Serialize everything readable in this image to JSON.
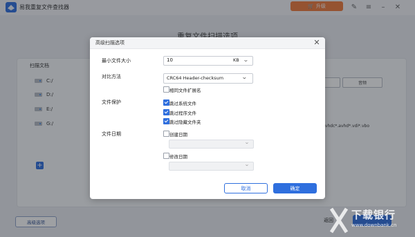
{
  "app": {
    "title": "易我重复文件查找器",
    "upgrade_label": "升级"
  },
  "main": {
    "page_title": "重复文件扫描选项",
    "scan_label": "扫描文档",
    "drives": [
      "C:/",
      "D:/",
      "E:/",
      "G:/"
    ],
    "add_symbol": "+",
    "partial_btn_label": "音频",
    "extensions_text": "*.vhdc*.avhd*.vdi*.vbo",
    "advanced_button": "高级选项",
    "back_button": "返回"
  },
  "dialog": {
    "title": "高级扫描选项",
    "min_size_label": "最小文件大小",
    "min_size_value": "10",
    "min_size_unit": "KB",
    "compare_label": "对比方法",
    "compare_value": "CRC64 Header-checksum",
    "same_ext_label": "相同文件扩展名",
    "same_ext_checked": false,
    "protect_label": "文件保护",
    "protect_options": [
      {
        "label": "跳过系统文件",
        "checked": true
      },
      {
        "label": "跳过程序文件",
        "checked": true
      },
      {
        "label": "跳过隐藏文件夹",
        "checked": true
      }
    ],
    "date_label": "文件日期",
    "created_label": "创建日期",
    "created_checked": false,
    "modified_label": "修改日期",
    "modified_checked": false,
    "cancel_label": "取消",
    "ok_label": "确定"
  },
  "watermark": {
    "main": "下载银行",
    "sub": "www.downbank.cn"
  },
  "colors": {
    "accent": "#2f6fde",
    "upgrade": "#f07a3c"
  }
}
